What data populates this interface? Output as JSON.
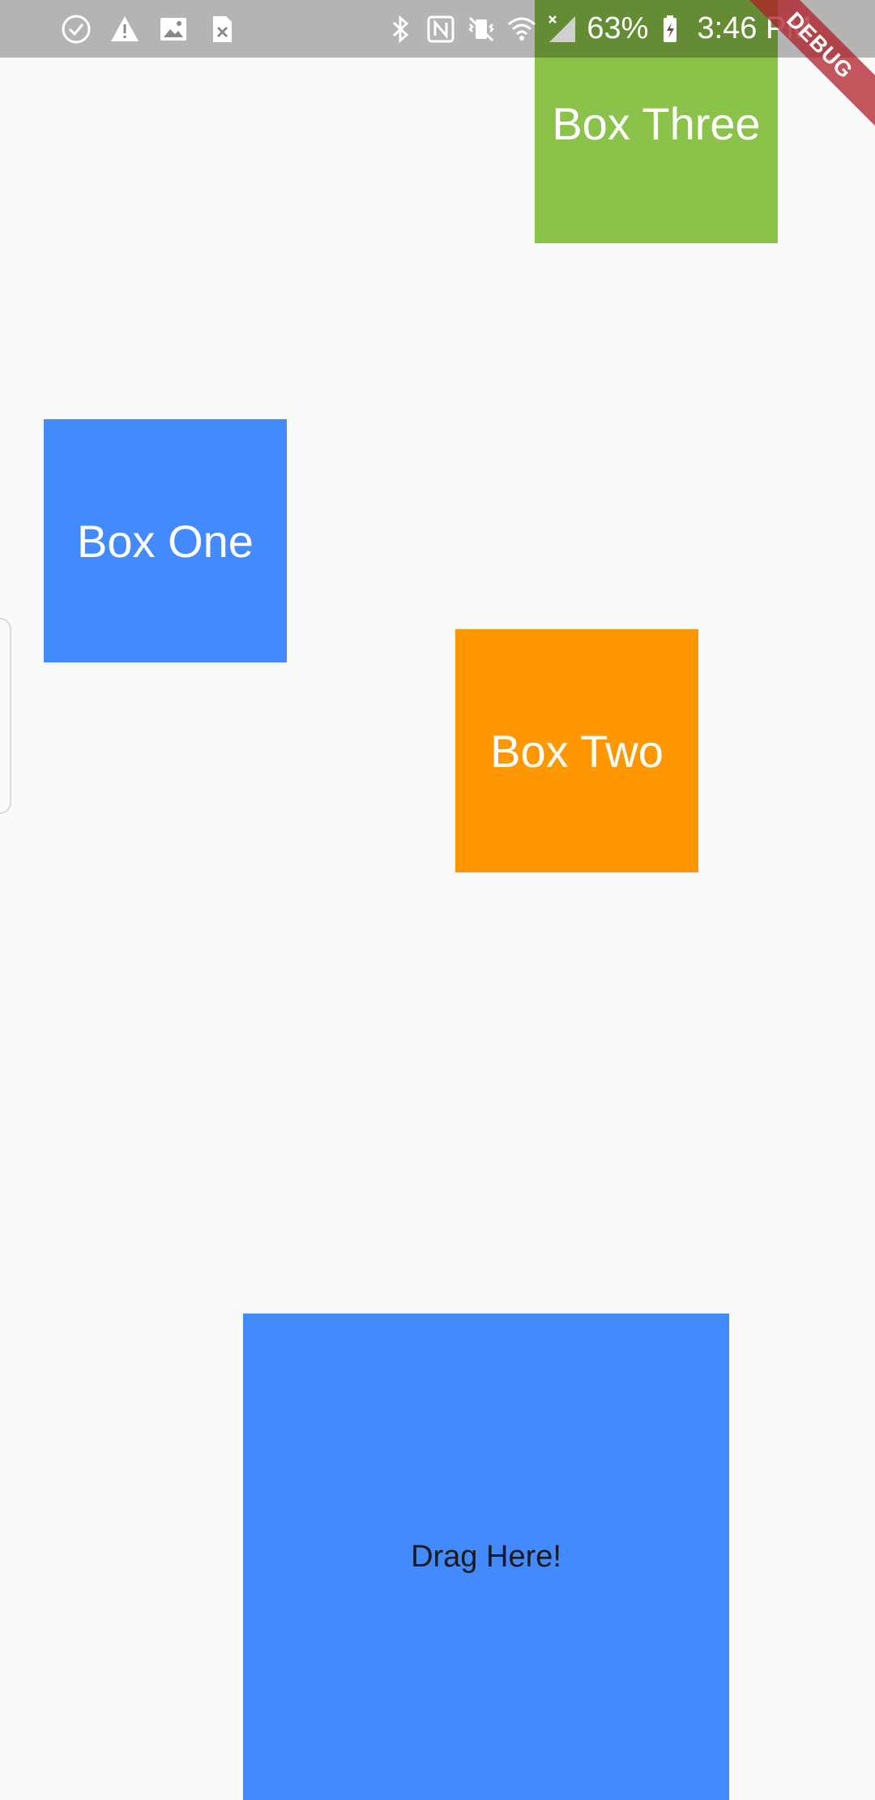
{
  "status_bar": {
    "battery_percent": "63%",
    "time": "3:46 PM",
    "left_icons": [
      "check-circle-icon",
      "warning-icon",
      "image-icon",
      "file-x-icon"
    ],
    "right_icons": [
      "bluetooth-icon",
      "nfc-icon",
      "vibrate-mute-icon",
      "wifi-icon",
      "cell-signal-icon",
      "battery-charging-icon"
    ]
  },
  "boxes": {
    "one": {
      "label": "Box One",
      "color": "#448AFF"
    },
    "two": {
      "label": "Box Two",
      "color": "#FF9800"
    },
    "three": {
      "label": "Box Three",
      "color": "#8BC34A"
    }
  },
  "drop_target": {
    "label": "Drag Here!",
    "color": "#448AFF"
  },
  "debug_banner": {
    "label": "DEBUG",
    "color": "#B01E28"
  }
}
